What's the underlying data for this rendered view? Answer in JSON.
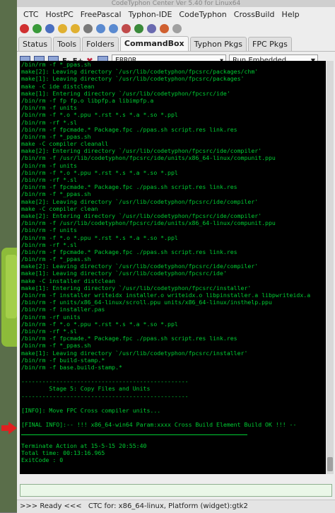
{
  "window": {
    "title": "CodeTyphon Center Ver 5.40 for Linux64"
  },
  "menu": [
    "CTC",
    "HostPC",
    "FreePascal",
    "Typhon-IDE",
    "CodeTyphon",
    "CrossBuild",
    "Help"
  ],
  "tabs": [
    "Status",
    "Tools",
    "Folders",
    "CommandBox",
    "Typhon Pkgs",
    "FPC Pkgs"
  ],
  "commandbar": {
    "f_minus": "F-",
    "f_plus": "F+",
    "level_select": "ERROR",
    "mode_select": "Run Embedded"
  },
  "console_lines": [
    "/bin/rm -f *_ppas.sh",
    "make[2]: Leaving directory `/usr/lib/codetyphon/fpcsrc/packages/chm'",
    "make[1]: Leaving directory `/usr/lib/codetyphon/fpcsrc/packages'",
    "make -C ide distclean",
    "make[1]: Entering directory `/usr/lib/codetyphon/fpcsrc/ide'",
    "/bin/rm -f fp fp.o libpfp.a libimpfp.a",
    "/bin/rm -f units",
    "/bin/rm -f *.o *.ppu *.rst *.s *.a *.so *.ppl",
    "/bin/rm -rf *.sl",
    "/bin/rm -f fpcmade.* Package.fpc ./ppas.sh script.res link.res",
    "/bin/rm -f *_ppas.sh",
    "make -C compiler cleanall",
    "make[2]: Entering directory `/usr/lib/codetyphon/fpcsrc/ide/compiler'",
    "/bin/rm -f /usr/lib/codetyphon/fpcsrc/ide/units/x86_64-linux/compunit.ppu",
    "/bin/rm -f units",
    "/bin/rm -f *.o *.ppu *.rst *.s *.a *.so *.ppl",
    "/bin/rm -rf *.sl",
    "/bin/rm -f fpcmade.* Package.fpc ./ppas.sh script.res link.res",
    "/bin/rm -f *_ppas.sh",
    "make[2]: Leaving directory `/usr/lib/codetyphon/fpcsrc/ide/compiler'",
    "make -C compiler clean",
    "make[2]: Entering directory `/usr/lib/codetyphon/fpcsrc/ide/compiler'",
    "/bin/rm -f /usr/lib/codetyphon/fpcsrc/ide/units/x86_64-linux/compunit.ppu",
    "/bin/rm -f units",
    "/bin/rm -f *.o *.ppu *.rst *.s *.a *.so *.ppl",
    "/bin/rm -rf *.sl",
    "/bin/rm -f fpcmade.* Package.fpc ./ppas.sh script.res link.res",
    "/bin/rm -f *_ppas.sh",
    "make[2]: Leaving directory `/usr/lib/codetyphon/fpcsrc/ide/compiler'",
    "make[1]: Leaving directory `/usr/lib/codetyphon/fpcsrc/ide'",
    "make -C installer distclean",
    "make[1]: Entering directory `/usr/lib/codetyphon/fpcsrc/installer'",
    "/bin/rm -f installer writeidx installer.o writeidx.o libpinstaller.a libpwriteidx.a",
    "/bin/rm -f units/x86_64-linux/scroll.ppu units/x86_64-linux/insthelp.ppu",
    "/bin/rm -f installer.pas",
    "/bin/rm -rf units",
    "/bin/rm -f *.o *.ppu *.rst *.s *.a *.so *.ppl",
    "/bin/rm -rf *.sl",
    "/bin/rm -f fpcmade.* Package.fpc ./ppas.sh script.res link.res",
    "/bin/rm -f *_ppas.sh",
    "make[1]: Leaving directory `/usr/lib/codetyphon/fpcsrc/installer'",
    "/bin/rm -f build-stamp.*",
    "/bin/rm -f base.build-stamp.*",
    "",
    "------------------------------------------------",
    "        Stage 5: Copy Files and Units",
    "------------------------------------------------",
    "",
    "[INFO]: Move FPC Cross compiler units...",
    "",
    "[FINAL INFO]:-- !!! x86_64-win64 Param:xxxx Cross Build Element Build OK !!! --"
  ],
  "console_footer": [
    "Terminate Action at 15-5-15 20:55:40",
    "Total time: 00:13:16.965",
    "ExitCode : 0"
  ],
  "status": {
    "ready": ">>> Ready <<<",
    "platform": "CTC for: x86_64-linux, Platform (widget):gtk2"
  },
  "colors": {
    "console_bg": "#000000",
    "console_text": "#00cc33",
    "arrow": "#e02020"
  }
}
